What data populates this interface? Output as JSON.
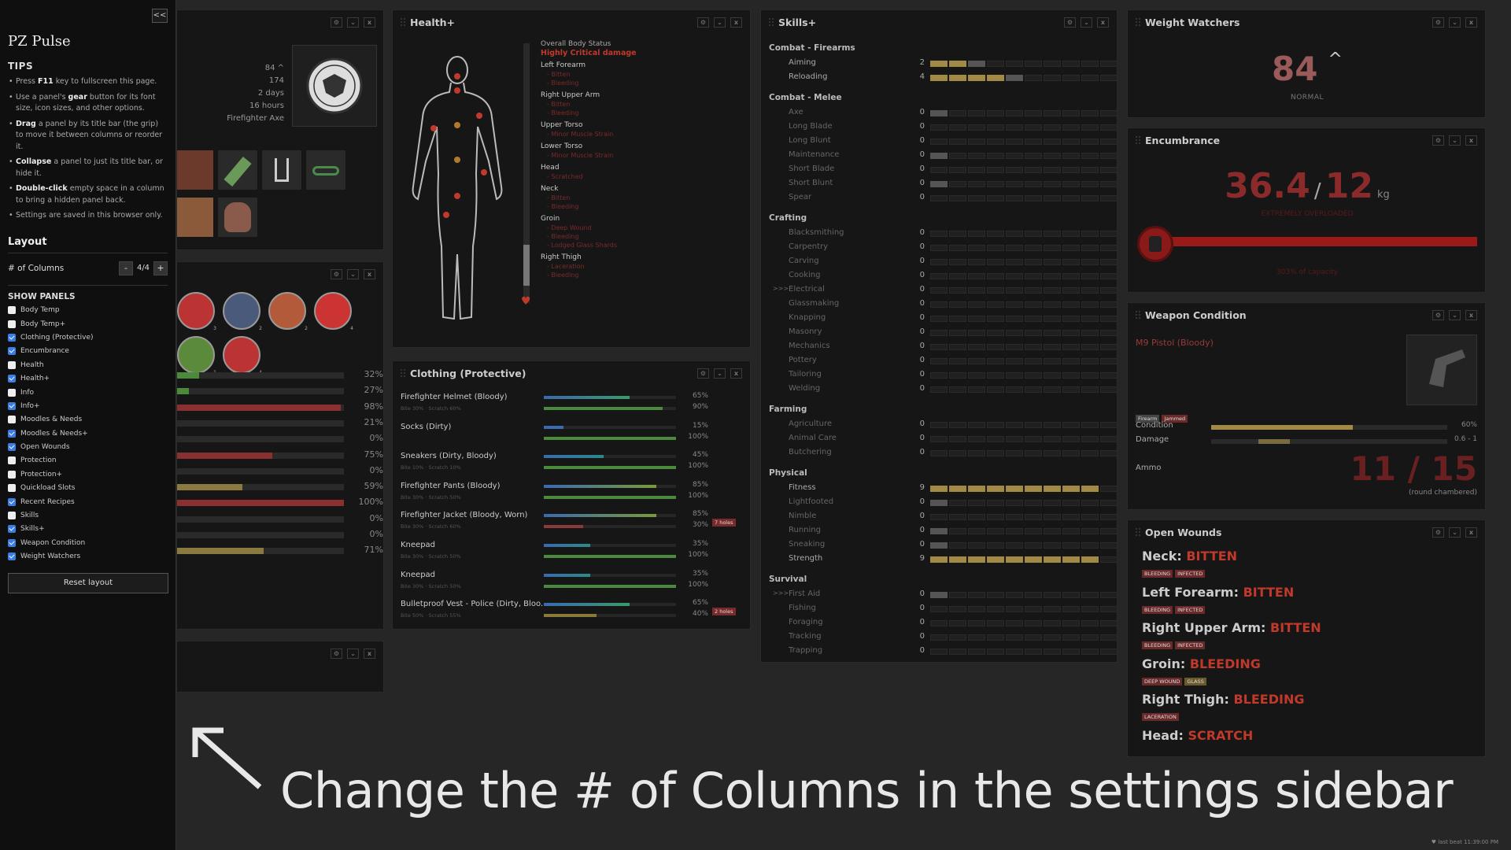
{
  "sidebar": {
    "collapse_label": "<<",
    "title": "PZ Pulse",
    "tips_heading": "TIPS",
    "tips": [
      {
        "pre": "Press ",
        "key": "F11",
        "post": " key to fullscreen this page."
      },
      {
        "pre": "Use a panel's ",
        "key": "gear",
        "post": " button for its font size, icon sizes, and other options."
      },
      {
        "pre": "",
        "key": "Drag",
        "post": " a panel by its title bar (the grip) to move it between columns or reorder it."
      },
      {
        "pre": "",
        "key": "Collapse",
        "post": " a panel to just its title bar, or hide it."
      },
      {
        "pre": "",
        "key": "Double-click",
        "post": " empty space in a column to bring a hidden panel back."
      },
      {
        "pre": "",
        "key": "",
        "post": "Settings are saved in this browser only."
      }
    ],
    "layout_heading": "Layout",
    "columns_label": "# of Columns",
    "columns_minus": "-",
    "columns_value": "4/4",
    "columns_plus": "+",
    "show_panels_heading": "SHOW PANELS",
    "panels": [
      {
        "label": "Body Temp",
        "checked": false
      },
      {
        "label": "Body Temp+",
        "checked": false
      },
      {
        "label": "Clothing (Protective)",
        "checked": true
      },
      {
        "label": "Encumbrance",
        "checked": true
      },
      {
        "label": "Health",
        "checked": false
      },
      {
        "label": "Health+",
        "checked": true
      },
      {
        "label": "Info",
        "checked": false
      },
      {
        "label": "Info+",
        "checked": true
      },
      {
        "label": "Moodles & Needs",
        "checked": false
      },
      {
        "label": "Moodles & Needs+",
        "checked": true
      },
      {
        "label": "Open Wounds",
        "checked": true
      },
      {
        "label": "Protection",
        "checked": false
      },
      {
        "label": "Protection+",
        "checked": false
      },
      {
        "label": "Quickload Slots",
        "checked": false
      },
      {
        "label": "Recent Recipes",
        "checked": true
      },
      {
        "label": "Skills",
        "checked": false
      },
      {
        "label": "Skills+",
        "checked": true
      },
      {
        "label": "Weapon Condition",
        "checked": true
      },
      {
        "label": "Weight Watchers",
        "checked": true
      }
    ],
    "reset_label": "Reset layout"
  },
  "panel_buttons": {
    "gear": "⚙",
    "collapse": "⌄",
    "close": "x"
  },
  "info": {
    "weight": "84 ^",
    "height": "174",
    "days": "2 days",
    "hours": "16 hours",
    "weapon": "Firefighter Axe"
  },
  "needs": {
    "rows": [
      {
        "pct": "32%",
        "value": 0.13,
        "color": "#4a8a3a"
      },
      {
        "pct": "27%",
        "value": 0.07,
        "color": "#4a8a3a"
      },
      {
        "pct": "98%",
        "value": 0.98,
        "color": "#8a3030"
      },
      {
        "pct": "21%",
        "value": 0.0,
        "color": "#4a8a3a"
      },
      {
        "pct": "0%",
        "value": 0.0,
        "color": "#4a8a3a"
      },
      {
        "pct": "75%",
        "value": 0.57,
        "color": "#8a3030"
      },
      {
        "pct": "0%",
        "value": 0.0,
        "color": "#4a8a3a"
      },
      {
        "pct": "59%",
        "value": 0.39,
        "color": "#8a7a40"
      },
      {
        "pct": "100%",
        "value": 1.0,
        "color": "#8a3030"
      },
      {
        "pct": "0%",
        "value": 0.0,
        "color": "#4a8a3a"
      },
      {
        "pct": "0%",
        "value": 0.0,
        "color": "#4a8a3a"
      },
      {
        "pct": "71%",
        "value": 0.52,
        "color": "#8a7a40"
      }
    ],
    "moodle_counts": [
      "3",
      "2",
      "2",
      "4",
      "1",
      "4"
    ]
  },
  "health": {
    "title": "Health+",
    "overall_label": "Overall Body Status",
    "overall_status": "Highly Critical damage",
    "parts": [
      {
        "name": "Left Forearm",
        "subs": [
          "- Bitten",
          "- Bleeding"
        ]
      },
      {
        "name": "Right Upper Arm",
        "subs": [
          "- Bitten",
          "- Bleeding"
        ]
      },
      {
        "name": "Upper Torso",
        "subs": [
          "- Minor Muscle Strain"
        ]
      },
      {
        "name": "Lower Torso",
        "subs": [
          "- Minor Muscle Strain"
        ]
      },
      {
        "name": "Head",
        "subs": [
          "- Scratched"
        ]
      },
      {
        "name": "Neck",
        "subs": [
          "- Bitten",
          "- Bleeding"
        ]
      },
      {
        "name": "Groin",
        "subs": [
          "- Deep Wound",
          "- Bleeding",
          "- Lodged Glass Shards"
        ]
      },
      {
        "name": "Right Thigh",
        "subs": [
          "- Laceration",
          "- Bleeding"
        ]
      }
    ]
  },
  "clothing": {
    "title": "Clothing (Protective)",
    "items": [
      {
        "name": "Firefighter Helmet (Bloody)",
        "sub": "Bite 30% · Scratch 60%",
        "cond_pct": "65%",
        "cond": 0.65,
        "cond_color": "#3a9a6a",
        "res_pct": "90%",
        "res": 0.9,
        "res_color": "#4a8a3a",
        "holes": ""
      },
      {
        "name": "Socks (Dirty)",
        "sub": "",
        "cond_pct": "15%",
        "cond": 0.15,
        "cond_color": "#3a6ab0",
        "res_pct": "100%",
        "res": 1.0,
        "res_color": "#4a8a3a",
        "holes": ""
      },
      {
        "name": "Sneakers (Dirty, Bloody)",
        "sub": "Bite 10% · Scratch 10%",
        "cond_pct": "45%",
        "cond": 0.45,
        "cond_color": "#2a8a8a",
        "res_pct": "100%",
        "res": 1.0,
        "res_color": "#4a8a3a",
        "holes": ""
      },
      {
        "name": "Firefighter Pants (Bloody)",
        "sub": "Bite 30% · Scratch 50%",
        "cond_pct": "85%",
        "cond": 0.85,
        "cond_color": "#7a9a3a",
        "res_pct": "100%",
        "res": 1.0,
        "res_color": "#4a8a3a",
        "holes": ""
      },
      {
        "name": "Firefighter Jacket (Bloody, Worn)",
        "sub": "Bite 30% · Scratch 60%",
        "cond_pct": "85%",
        "cond": 0.85,
        "cond_color": "#7a9a3a",
        "res_pct": "30%",
        "res": 0.3,
        "res_color": "#8a3a3a",
        "holes": "7 holes"
      },
      {
        "name": "Kneepad",
        "sub": "Bite 30% · Scratch 50%",
        "cond_pct": "35%",
        "cond": 0.35,
        "cond_color": "#2a8a8a",
        "res_pct": "100%",
        "res": 1.0,
        "res_color": "#4a8a3a",
        "holes": ""
      },
      {
        "name": "Kneepad",
        "sub": "Bite 30% · Scratch 50%",
        "cond_pct": "35%",
        "cond": 0.35,
        "cond_color": "#2a8a8a",
        "res_pct": "100%",
        "res": 1.0,
        "res_color": "#4a8a3a",
        "holes": ""
      },
      {
        "name": "Bulletproof Vest - Police (Dirty, Bloo...",
        "sub": "Bite 50% · Scratch 55%",
        "cond_pct": "65%",
        "cond": 0.65,
        "cond_color": "#3a9a6a",
        "res_pct": "40%",
        "res": 0.4,
        "res_color": "#8a7a3a",
        "holes": "2 holes"
      }
    ]
  },
  "skills": {
    "title": "Skills+",
    "groups": [
      {
        "name": "Combat - Firearms",
        "skills": [
          {
            "name": "Aiming",
            "level": 2,
            "progress": 0.7,
            "active": true
          },
          {
            "name": "Reloading",
            "level": 4,
            "progress": 0.6,
            "active": true
          }
        ]
      },
      {
        "name": "Combat - Melee",
        "skills": [
          {
            "name": "Axe",
            "level": 0,
            "progress": 0.2,
            "active": false
          },
          {
            "name": "Long Blade",
            "level": 0,
            "progress": 0,
            "active": false
          },
          {
            "name": "Long Blunt",
            "level": 0,
            "progress": 0,
            "active": false
          },
          {
            "name": "Maintenance",
            "level": 0,
            "progress": 0.1,
            "active": false
          },
          {
            "name": "Short Blade",
            "level": 0,
            "progress": 0,
            "active": false
          },
          {
            "name": "Short Blunt",
            "level": 0,
            "progress": 0.1,
            "active": false
          },
          {
            "name": "Spear",
            "level": 0,
            "progress": 0,
            "active": false
          }
        ]
      },
      {
        "name": "Crafting",
        "skills": [
          {
            "name": "Blacksmithing",
            "level": 0,
            "progress": 0,
            "active": false
          },
          {
            "name": "Carpentry",
            "level": 0,
            "progress": 0,
            "active": false
          },
          {
            "name": "Carving",
            "level": 0,
            "progress": 0,
            "active": false
          },
          {
            "name": "Cooking",
            "level": 0,
            "progress": 0,
            "active": false
          },
          {
            "name": "Electrical",
            "level": 0,
            "progress": 0,
            "active": false,
            "arrow": ">>>"
          },
          {
            "name": "Glassmaking",
            "level": 0,
            "progress": 0,
            "active": false
          },
          {
            "name": "Knapping",
            "level": 0,
            "progress": 0,
            "active": false
          },
          {
            "name": "Masonry",
            "level": 0,
            "progress": 0,
            "active": false
          },
          {
            "name": "Mechanics",
            "level": 0,
            "progress": 0,
            "active": false
          },
          {
            "name": "Pottery",
            "level": 0,
            "progress": 0,
            "active": false
          },
          {
            "name": "Tailoring",
            "level": 0,
            "progress": 0,
            "active": false
          },
          {
            "name": "Welding",
            "level": 0,
            "progress": 0,
            "active": false
          }
        ]
      },
      {
        "name": "Farming",
        "skills": [
          {
            "name": "Agriculture",
            "level": 0,
            "progress": 0,
            "active": false
          },
          {
            "name": "Animal Care",
            "level": 0,
            "progress": 0,
            "active": false
          },
          {
            "name": "Butchering",
            "level": 0,
            "progress": 0,
            "active": false
          }
        ]
      },
      {
        "name": "Physical",
        "skills": [
          {
            "name": "Fitness",
            "level": 9,
            "progress": 0,
            "active": true
          },
          {
            "name": "Lightfooted",
            "level": 0,
            "progress": 0.3,
            "active": false
          },
          {
            "name": "Nimble",
            "level": 0,
            "progress": 0,
            "active": false
          },
          {
            "name": "Running",
            "level": 0,
            "progress": 0.5,
            "active": false
          },
          {
            "name": "Sneaking",
            "level": 0,
            "progress": 0.2,
            "active": false
          },
          {
            "name": "Strength",
            "level": 9,
            "progress": 0,
            "active": true
          }
        ]
      },
      {
        "name": "Survival",
        "skills": [
          {
            "name": "First Aid",
            "level": 0,
            "progress": 0.2,
            "active": false,
            "arrow": ">>>"
          },
          {
            "name": "Fishing",
            "level": 0,
            "progress": 0,
            "active": false
          },
          {
            "name": "Foraging",
            "level": 0,
            "progress": 0,
            "active": false
          },
          {
            "name": "Tracking",
            "level": 0,
            "progress": 0,
            "active": false
          },
          {
            "name": "Trapping",
            "level": 0,
            "progress": 0,
            "active": false
          }
        ]
      }
    ]
  },
  "weight": {
    "title": "Weight Watchers",
    "value": "84",
    "trend": "^",
    "status": "NORMAL"
  },
  "encumbrance": {
    "title": "Encumbrance",
    "current": "36.4",
    "slash": "/",
    "max": "12",
    "unit": "kg",
    "status": "EXTREMELY OVERLOADED",
    "capacity_text": "303% of capacity",
    "fill": 1.0
  },
  "weapon": {
    "title": "Weapon Condition",
    "name": "M9 Pistol (Bloody)",
    "tags": [
      "Firearm",
      "Jammed"
    ],
    "condition_label": "Condition",
    "condition_pct": "60%",
    "condition": 0.6,
    "damage_label": "Damage",
    "damage_range": "0.6 - 1",
    "ammo_label": "Ammo",
    "ammo": "11 / 15",
    "ammo_note": "(round chambered)"
  },
  "wounds": {
    "title": "Open Wounds",
    "items": [
      {
        "part": "Neck:",
        "status": "BITTEN",
        "tags": [
          "BLEEDING",
          "INFECTED"
        ]
      },
      {
        "part": "Left Forearm:",
        "status": "BITTEN",
        "tags": [
          "BLEEDING",
          "INFECTED"
        ]
      },
      {
        "part": "Right Upper Arm:",
        "status": "BITTEN",
        "tags": [
          "BLEEDING",
          "INFECTED"
        ]
      },
      {
        "part": "Groin:",
        "status": "BLEEDING",
        "tags": [
          "DEEP WOUND",
          "GLASS"
        ]
      },
      {
        "part": "Right Thigh:",
        "status": "BLEEDING",
        "tags": [
          "LACERATION"
        ]
      },
      {
        "part": "Head:",
        "status": "SCRATCH",
        "tags": []
      }
    ]
  },
  "caption": "Change the # of Columns in the settings sidebar",
  "footer": "last beat 11:39:00 PM"
}
